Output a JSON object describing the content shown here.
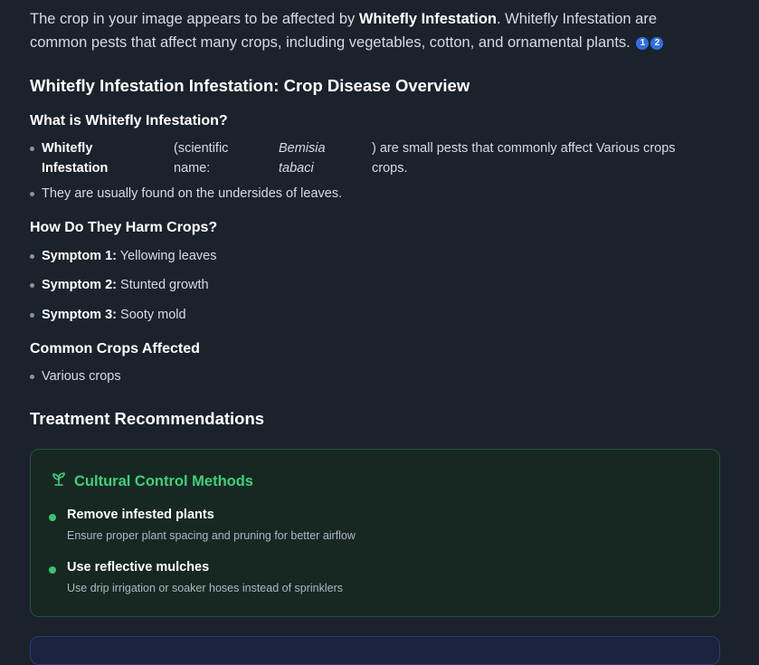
{
  "intro": {
    "text_before": "The crop in your image appears to be affected by ",
    "pest_bold": "Whitefly Infestation",
    "text_after": ". Whitefly Infestation are common pests that affect many crops, including vegetables, cotton, and ornamental plants.",
    "citations": [
      "1",
      "2"
    ]
  },
  "overview_title": "Whitefly Infestation Infestation: Crop Disease Overview",
  "what_is": {
    "heading": "What is Whitefly Infestation?",
    "item1": {
      "name": "Whitefly Infestation",
      "sci_label": "(scientific name:",
      "sci_name": "Bemisia tabaci",
      "rest": ") are small pests that commonly affect Various crops crops."
    },
    "item2": "They are usually found on the undersides of leaves."
  },
  "harm": {
    "heading": "How Do They Harm Crops?",
    "symptoms": [
      {
        "label": "Symptom 1:",
        "value": "Yellowing leaves"
      },
      {
        "label": "Symptom 2:",
        "value": "Stunted growth"
      },
      {
        "label": "Symptom 3:",
        "value": "Sooty mold"
      }
    ]
  },
  "crops": {
    "heading": "Common Crops Affected",
    "items": [
      "Various crops"
    ]
  },
  "treatment": {
    "heading": "Treatment Recommendations",
    "card": {
      "icon": "sprout-icon",
      "title": "Cultural Control Methods",
      "accent": "#3fd07a",
      "items": [
        {
          "title": "Remove infested plants",
          "desc": "Ensure proper plant spacing and pruning for better airflow"
        },
        {
          "title": "Use reflective mulches",
          "desc": "Use drip irrigation or soaker hoses instead of sprinklers"
        }
      ]
    }
  }
}
